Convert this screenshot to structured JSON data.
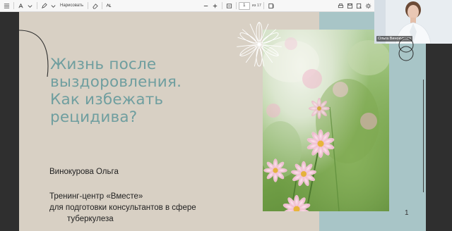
{
  "toolbar": {
    "draw_label": "Нарисовать",
    "page_current": "1",
    "page_total": "из 17"
  },
  "slide": {
    "title_lines": [
      "Жизнь после",
      "выздоровления.",
      "Как избежать",
      "рецидива?"
    ],
    "author": "Винокурова Ольга",
    "org_line1": "Тренинг-центр «Вместе»",
    "org_line2": "для подготовки консультантов в сфере",
    "org_line3": "туберкулеза",
    "page_number": "1"
  },
  "webcam": {
    "participant_name": "Ольга Винокурова"
  },
  "colors": {
    "slide_background": "#d8d0c4",
    "title_teal": "#6f9e9f",
    "teal_band": "#a8c5c7"
  }
}
